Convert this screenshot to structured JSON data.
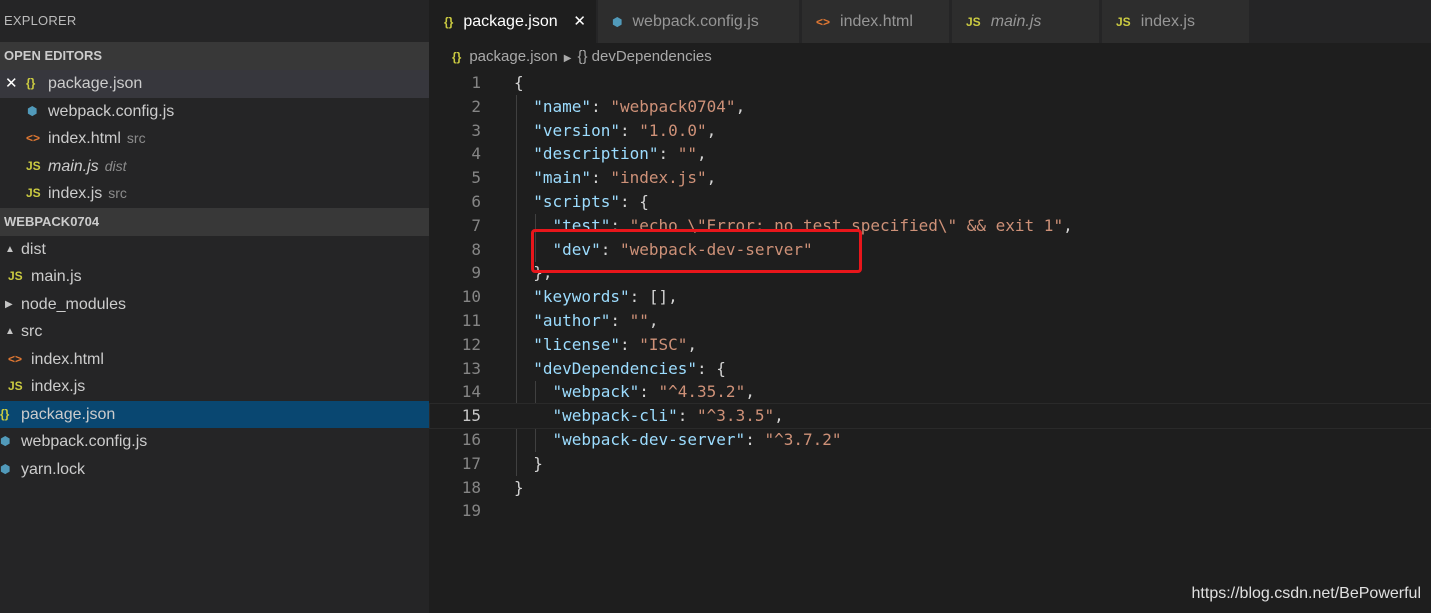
{
  "explorer": {
    "title": "EXPLORER",
    "open_editors_header": "OPEN EDITORS",
    "open_editors": [
      {
        "name": "package.json",
        "desc": "",
        "icon": "{}"
      },
      {
        "name": "webpack.config.js",
        "desc": "",
        "icon": "⬢"
      },
      {
        "name": "index.html",
        "desc": "src",
        "icon": "<>"
      },
      {
        "name": "main.js",
        "desc": "dist",
        "icon": "JS"
      },
      {
        "name": "index.js",
        "desc": "src",
        "icon": "JS"
      }
    ],
    "project_header": "WEBPACK0704",
    "tree": [
      {
        "name": "dist",
        "icon": "▲"
      },
      {
        "name": "main.js",
        "icon": "JS"
      },
      {
        "name": "node_modules",
        "icon": "▶"
      },
      {
        "name": "src",
        "icon": "▲"
      },
      {
        "name": "index.html",
        "icon": "<>"
      },
      {
        "name": "index.js",
        "icon": "JS"
      },
      {
        "name": "package.json",
        "icon": "{}"
      },
      {
        "name": "webpack.config.js",
        "icon": "⬢"
      },
      {
        "name": "yarn.lock",
        "icon": "⬢"
      }
    ]
  },
  "tabs": [
    {
      "label": "package.json",
      "icon": "{}",
      "close": "✕"
    },
    {
      "label": "webpack.config.js",
      "icon": "⬢"
    },
    {
      "label": "index.html",
      "icon": "<>"
    },
    {
      "label": "main.js",
      "icon": "JS"
    },
    {
      "label": "index.js",
      "icon": "JS"
    }
  ],
  "breadcrumb": {
    "file": "package.json",
    "file_icon": "{}",
    "separator": "▶",
    "symbol_icon": "{}",
    "symbol": "devDependencies"
  },
  "code": {
    "line_numbers": [
      "1",
      "2",
      "3",
      "4",
      "5",
      "6",
      "7",
      "8",
      "9",
      "10",
      "11",
      "12",
      "13",
      "14",
      "15",
      "16",
      "17",
      "18",
      "19"
    ],
    "lines": [
      "{",
      "  \"name\": \"webpack0704\",",
      "  \"version\": \"1.0.0\",",
      "  \"description\": \"\",",
      "  \"main\": \"index.js\",",
      "  \"scripts\": {",
      "    \"test\": \"echo \\\"Error: no test specified\\\" && exit 1\",",
      "    \"dev\": \"webpack-dev-server\"",
      "  },",
      "  \"keywords\": [],",
      "  \"author\": \"\",",
      "  \"license\": \"ISC\",",
      "  \"devDependencies\": {",
      "    \"webpack\": \"^4.35.2\",",
      "    \"webpack-cli\": \"^3.3.5\",",
      "    \"webpack-dev-server\": \"^3.7.2\"",
      "  }",
      "}",
      ""
    ],
    "current_line": "15"
  },
  "watermark": "https://blog.csdn.net/BePowerful",
  "colors": {
    "json_icon": "#cbcb41",
    "html_icon": "#e37933",
    "js_icon": "#cbcb41",
    "webpack_icon": "#519aba",
    "selection": "#094771",
    "highlight_box": "#e8161b"
  }
}
